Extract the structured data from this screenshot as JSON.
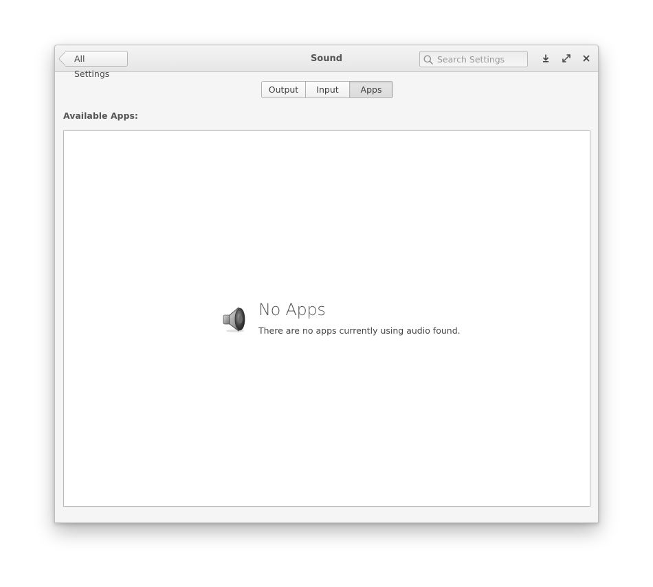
{
  "window": {
    "title": "Sound"
  },
  "header": {
    "back_label": "All Settings",
    "search_placeholder": "Search Settings"
  },
  "tabs": [
    {
      "label": "Output",
      "active": false
    },
    {
      "label": "Input",
      "active": false
    },
    {
      "label": "Apps",
      "active": true
    }
  ],
  "apps_section": {
    "label": "Available Apps:",
    "empty_title": "No Apps",
    "empty_description": "There are no apps currently using audio found.",
    "empty_icon": "speaker-icon"
  },
  "icons": {
    "search": "search-icon",
    "download": "download-icon",
    "maximize": "maximize-icon",
    "close": "close-icon"
  }
}
